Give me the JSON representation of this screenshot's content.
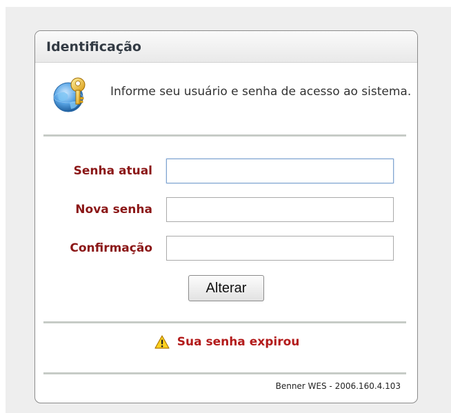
{
  "panel": {
    "title": "Identificação",
    "info_text": "Informe seu usuário e senha de acesso ao sistema.",
    "info_icon": "globe-key-icon"
  },
  "form": {
    "current_password": {
      "label": "Senha atual",
      "value": "",
      "placeholder": ""
    },
    "new_password": {
      "label": "Nova senha",
      "value": "",
      "placeholder": ""
    },
    "confirmation": {
      "label": "Confirmação",
      "value": "",
      "placeholder": ""
    },
    "submit_label": "Alterar"
  },
  "message": {
    "icon": "warning-icon",
    "text": "Sua senha expirou"
  },
  "footer": {
    "version": "Benner WES - 2006.160.4.103"
  },
  "colors": {
    "label": "#8b1717",
    "warning": "#b31b1b",
    "divider": "#c6cbc6",
    "focus_border": "#7da2ce"
  }
}
